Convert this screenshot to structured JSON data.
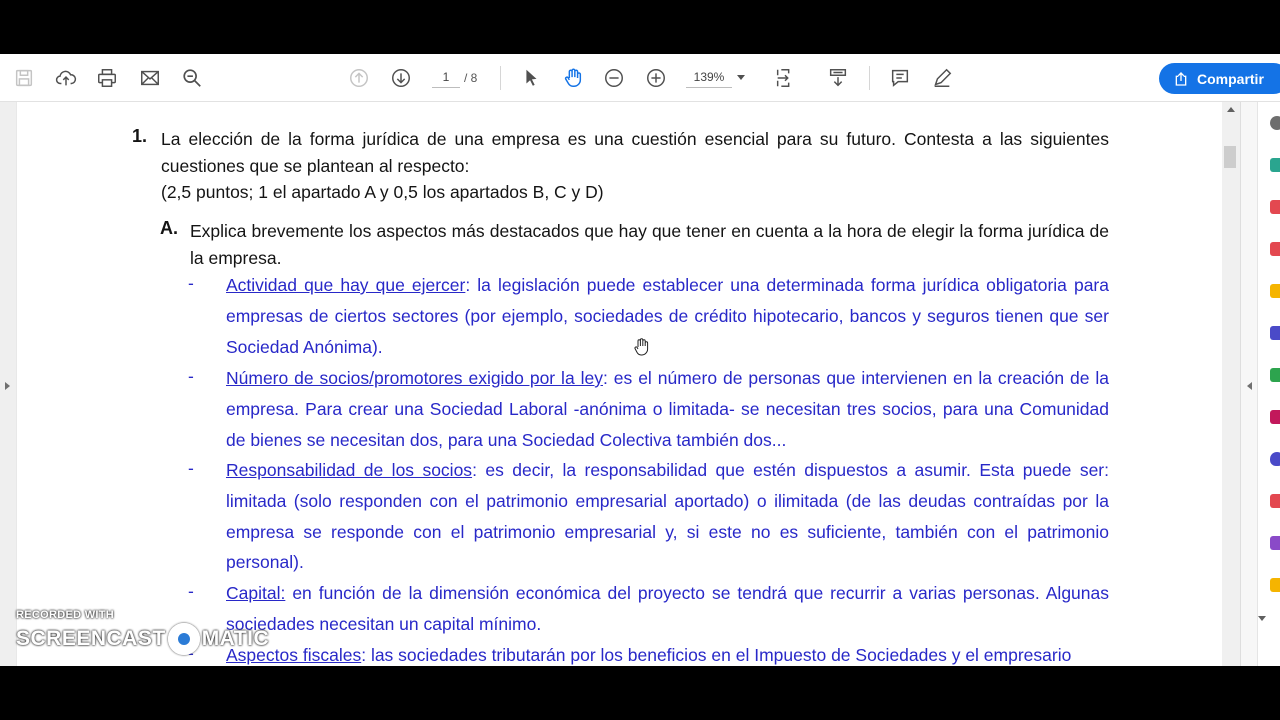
{
  "toolbar": {
    "page_current": "1",
    "page_total": "/ 8",
    "zoom": "139%",
    "share_label": "Compartir",
    "icons": [
      "save-icon",
      "upload-icon",
      "print-icon",
      "email-icon",
      "zoom-search-icon",
      "prev-page-icon",
      "next-page-icon",
      "select-cursor-icon",
      "hand-tool-icon",
      "zoom-out-icon",
      "zoom-in-icon",
      "fit-page-icon",
      "scroll-mode-icon",
      "comment-icon",
      "pen-icon"
    ]
  },
  "colors": {
    "accent": "#1473e6",
    "body_text": "#141414",
    "answer_text": "#2828c8"
  },
  "document": {
    "question": {
      "number": "1.",
      "text": "La elección de la forma jurídica de una empresa es una cuestión esencial para su futuro. Contesta a las siguientes cuestiones que se plantean al respecto:",
      "points": "(2,5 puntos; 1 el apartado A y 0,5 los apartados B, C y D)"
    },
    "part_a": {
      "letter": "A.",
      "text": "Explica brevemente los aspectos más destacados que hay que tener en cuenta a la hora de elegir la forma jurídica de la empresa."
    },
    "items": [
      {
        "dash": "-",
        "title": "Actividad que hay que ejercer",
        "sep": ":",
        "text": " la legislación puede establecer una determinada forma jurídica obligatoria para empresas de ciertos sectores (por ejemplo, sociedades de crédito hipotecario, bancos y seguros tienen que ser Sociedad Anónima)."
      },
      {
        "dash": "-",
        "title": "Número de socios/promotores exigido por la ley",
        "sep": ":",
        "text": " es el número de personas que intervienen en la creación de la empresa. Para crear una Sociedad Laboral -anónima o limitada- se necesitan tres socios, para una Comunidad de bienes se necesitan dos, para una Sociedad Colectiva también dos..."
      },
      {
        "dash": "-",
        "title": "Responsabilidad de los socios",
        "sep": ":",
        "text": " es decir, la responsabilidad que estén dispuestos a asumir. Esta puede ser: limitada (solo responden con el patrimonio empresarial aportado) o ilimitada (de las deudas contraídas por la empresa se responde con el patrimonio empresarial y, si este no es suficiente, también con el patrimonio personal)."
      },
      {
        "dash": "-",
        "title": "Capital:",
        "sep": "",
        "text": " en función de la dimensión económica del proyecto se tendrá que recurrir a varias personas. Algunas sociedades necesitan un capital mínimo."
      },
      {
        "dash": "-",
        "title": "Aspectos fiscales",
        "sep": ":",
        "text": " las sociedades tributarán por los beneficios en el Impuesto de Sociedades y el empresario"
      }
    ]
  },
  "watermark": {
    "line1": "RECORDED WITH",
    "line2a": "SCREENCAST",
    "line2b": "MATIC"
  }
}
